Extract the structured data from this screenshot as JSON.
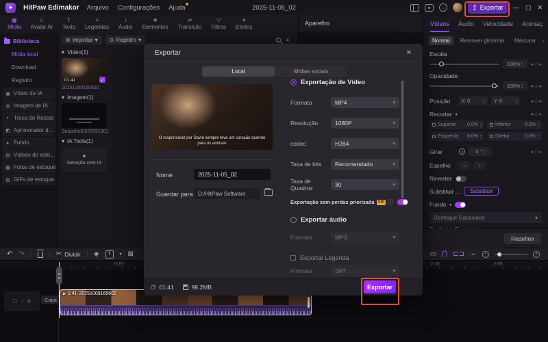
{
  "icons": {
    "logo": "✦",
    "upload": "↥",
    "minimize": "—",
    "maximize": "▢",
    "close": "✕",
    "caret": "▾",
    "chev_down": "▾",
    "chev_right": "›",
    "list": "≡",
    "import": "⊕",
    "record": "⊙",
    "check": "✓",
    "play": "▶",
    "kf_left": "◂",
    "kf_diamond": "◇",
    "kf_right": "▸",
    "stepper": "▴▾",
    "flip_h": "↔",
    "flip_v": "↕",
    "undo": "↶",
    "redo": "↷",
    "scissors": "✂",
    "marker": "◈",
    "text_tool": "T",
    "remove_gap": "⊠",
    "link": "▭",
    "magnet": "⋂",
    "bracket": "⊏⊐",
    "fit": "⇔",
    "minus": "−",
    "plus": "+",
    "info": "ⓘ",
    "clock": "◷",
    "sparkle": "✦",
    "degree": "°"
  },
  "titlebar": {
    "app_name": "HitPaw Edimakor",
    "menu": [
      "Arquivo",
      "Configurações",
      "Ajuda"
    ],
    "project_title": "2025-11-05_02",
    "export_button": "Exportar"
  },
  "tool_tabs": [
    {
      "label": "Mídia",
      "glyph": "▦"
    },
    {
      "label": "Avatar AI",
      "glyph": "☺"
    },
    {
      "label": "Texto",
      "glyph": "T"
    },
    {
      "label": "Legendas",
      "glyph": "≡"
    },
    {
      "label": "Áudio",
      "glyph": "♪"
    },
    {
      "label": "Elementos",
      "glyph": "❖"
    },
    {
      "label": "Transição",
      "glyph": "⇄"
    },
    {
      "label": "Filtros",
      "glyph": "▽"
    },
    {
      "label": "Efeitos",
      "glyph": "✦"
    }
  ],
  "sidebar": {
    "items": [
      {
        "label": "Biblioteca"
      },
      {
        "label": "Mídia local"
      },
      {
        "label": "Download"
      },
      {
        "label": "Registro"
      },
      {
        "label": "Vídeo de IA",
        "glyph": "▣"
      },
      {
        "label": "Imagem de IA",
        "glyph": "◍"
      },
      {
        "label": "Troca de Rostos",
        "glyph": "◐"
      },
      {
        "label": "Aprimorador d...",
        "glyph": "◩"
      },
      {
        "label": "Fundo",
        "glyph": "▸"
      },
      {
        "label": "Vídeos de esto...",
        "glyph": "▤"
      },
      {
        "label": "Fotos de estoque",
        "glyph": "▦"
      },
      {
        "label": "GIFs de estoque",
        "glyph": "▧"
      }
    ]
  },
  "media_panel": {
    "import_button": "Importar",
    "record_button": "Registro",
    "video_section": {
      "header": "Vídeo(1)",
      "item_name": "20251009165602",
      "item_duration": "01:41"
    },
    "image_section": {
      "header": "Imagem(1)",
      "item_name": "Snapshot2025091901"
    },
    "tools_section": {
      "header": "IA Tools(1)",
      "item_name": "Geração com IA"
    }
  },
  "preview": {
    "header": "Aparelho"
  },
  "inspector": {
    "tabs": [
      {
        "label": "Vídeos"
      },
      {
        "label": "Áudio"
      },
      {
        "label": "Velocidade"
      },
      {
        "label": "Animaç"
      }
    ],
    "chips": [
      {
        "label": "Normal"
      },
      {
        "label": "Remover glicemia"
      },
      {
        "label": "Máscara"
      }
    ],
    "scale": {
      "label": "Escala",
      "value": "100%"
    },
    "opacity": {
      "label": "Opacidade",
      "value": "100%"
    },
    "position": {
      "label": "Posição",
      "x_label": "X",
      "x": "0",
      "y_label": "Y",
      "y": "0"
    },
    "crop": {
      "label": "Recortar",
      "top_label": "Superior",
      "top": "0.0%",
      "bottom_label": "Inferior",
      "bottom": "0.0%",
      "left_label": "Esquerda",
      "left": "0.0%",
      "right_label": "Direita",
      "right": "0.0%"
    },
    "rotate": {
      "label": "Girar",
      "value": "0 °"
    },
    "mirror": {
      "label": "Espelho"
    },
    "reverse": {
      "label": "Reverter"
    },
    "replace": {
      "label": "Substituir ...",
      "button": "Substituir"
    },
    "background": {
      "label": "Fundo",
      "select_value": "Desfoque Gaussiano",
      "option_below": "Desfoque Gaussiano"
    },
    "reset_button": "Redefinir"
  },
  "dialog": {
    "title": "Exportar",
    "tabs": [
      {
        "label": "Local"
      },
      {
        "label": "Mídias sociais"
      }
    ],
    "preview_caption": "O responsável por David sempre teve um coração querido para os animais",
    "name_field": {
      "label": "Nome",
      "value": "2025-11-05_02"
    },
    "path_field": {
      "label": "Guardar para",
      "value": "D:/HitPaw Software"
    },
    "video_radio": "Exportação de Vídeo",
    "fields": [
      {
        "label": "Formato",
        "value": "MP4"
      },
      {
        "label": "Resolução",
        "value": "1080P"
      },
      {
        "label": "codec",
        "value": "H264"
      },
      {
        "label": "Taxa de bits",
        "value": "Recomendado"
      },
      {
        "label": "Taxa de Quadros",
        "value": "30"
      }
    ],
    "lossless": {
      "label": "Exportação sem perdas priorizada",
      "badge": "VIP"
    },
    "audio": {
      "radio_label": "Exportar áudio",
      "format_label": "Formato",
      "format_value": "MP3"
    },
    "subtitle": {
      "checkbox_label": "Exportar Legenda",
      "format_label": "Formato",
      "format_value": "SRT"
    },
    "footer": {
      "duration": "01:41",
      "size": "98.2MB",
      "export_button": "Exportar"
    }
  },
  "timeline": {
    "split_label": "Dividir",
    "ruler_ticks": [
      "0:25",
      "2:30",
      "2:55"
    ],
    "cover_button": "Capa",
    "clip": {
      "duration": "1:41",
      "name": "20251009165602"
    }
  }
}
